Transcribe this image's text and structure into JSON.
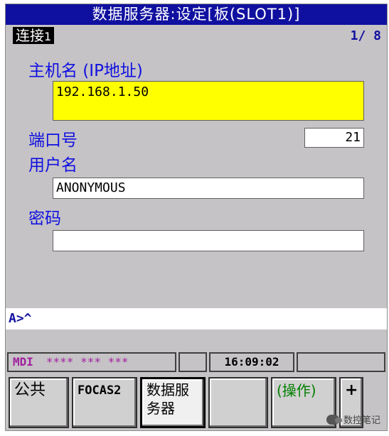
{
  "screen": {
    "title": "数据服务器:设定[板(SLOT1)]",
    "connection_label": "连接",
    "connection_number": "1",
    "page_indicator": "1/ 8"
  },
  "fields": {
    "host": {
      "label": "主机名 (IP地址)",
      "value": "192.168.1.50"
    },
    "port": {
      "label": "端口号",
      "value": "21"
    },
    "user": {
      "label": "用户名",
      "value": "ANONYMOUS"
    },
    "password": {
      "label": "密码",
      "value": ""
    }
  },
  "command_line": "A>^",
  "status": {
    "mode": "MDI",
    "placeholder": "**** *** ***",
    "time": "16:09:02"
  },
  "softkeys": [
    "公共",
    "FOCAS2",
    "数据服务器",
    "",
    "(操作)",
    "+"
  ],
  "watermark": {
    "text": "数控笔记"
  },
  "colors": {
    "title_bg": "#1010a0",
    "label": "#1010e0",
    "active_field": "#ffff00",
    "mode_text": "#a020a0",
    "operation_text": "#008000"
  }
}
